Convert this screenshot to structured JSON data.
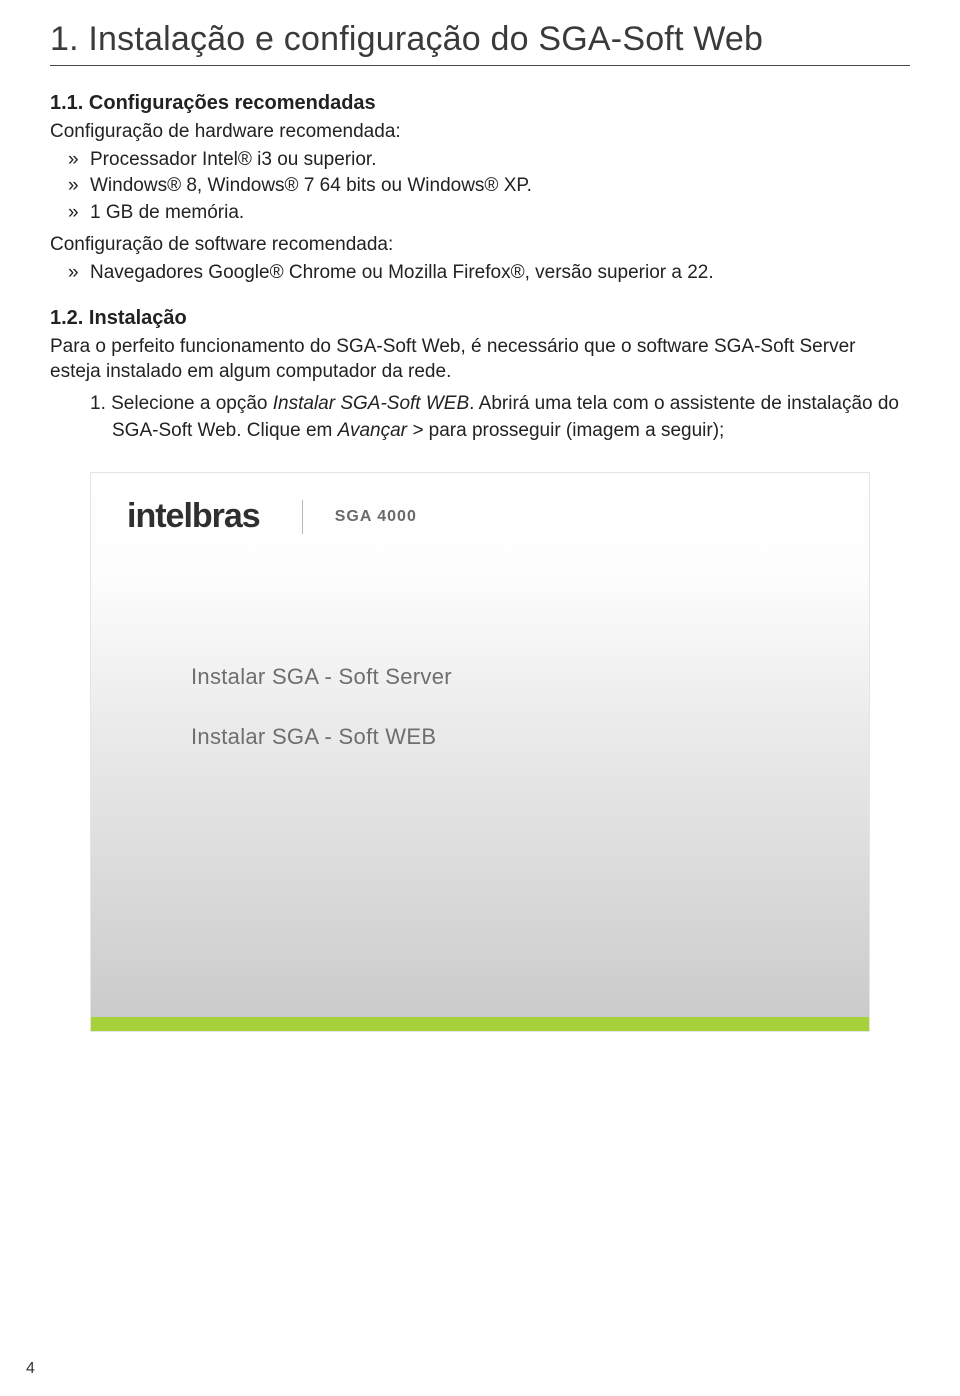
{
  "heading": "1. Instalação e configuração do SGA-Soft Web",
  "section11": {
    "title": "1.1. Configurações recomendadas",
    "hw_intro": "Configuração de hardware recomendada:",
    "hw_items": [
      "Processador Intel® i3 ou superior.",
      "Windows® 8, Windows® 7 64 bits ou Windows® XP.",
      "1 GB de memória."
    ],
    "sw_intro": "Configuração de software recomendada:",
    "sw_items": [
      "Navegadores Google® Chrome ou Mozilla Firefox®, versão superior a 22."
    ]
  },
  "section12": {
    "title": "1.2. Instalação",
    "intro": "Para o perfeito funcionamento do SGA-Soft Web, é necessário que o software SGA-Soft Server esteja instalado em algum computador da rede.",
    "step_num": "1. ",
    "step_a": "Selecione a opção ",
    "step_italic": "Instalar SGA-Soft WEB",
    "step_b": ". Abrirá uma tela com o assistente de instalação do SGA-Soft Web. Clique em ",
    "step_italic2": "Avançar >",
    "step_c": " para prosseguir (imagem a seguir);"
  },
  "installer": {
    "brand": "intelbras",
    "product": "SGA 4000",
    "menu": [
      "Instalar SGA - Soft Server",
      "Instalar SGA - Soft WEB"
    ]
  },
  "page_number": "4"
}
